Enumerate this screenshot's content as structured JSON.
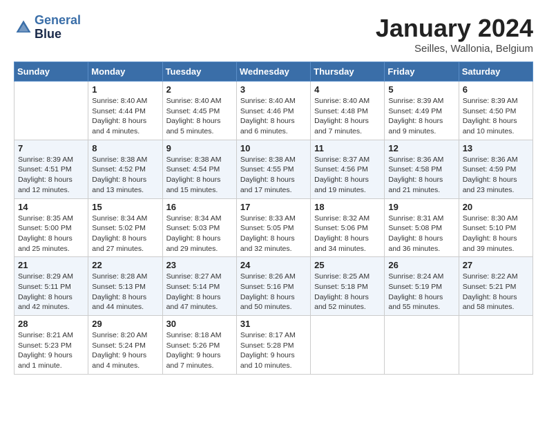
{
  "header": {
    "logo_line1": "General",
    "logo_line2": "Blue",
    "month_title": "January 2024",
    "subtitle": "Seilles, Wallonia, Belgium"
  },
  "days_of_week": [
    "Sunday",
    "Monday",
    "Tuesday",
    "Wednesday",
    "Thursday",
    "Friday",
    "Saturday"
  ],
  "weeks": [
    [
      {
        "day": "",
        "info": ""
      },
      {
        "day": "1",
        "info": "Sunrise: 8:40 AM\nSunset: 4:44 PM\nDaylight: 8 hours\nand 4 minutes."
      },
      {
        "day": "2",
        "info": "Sunrise: 8:40 AM\nSunset: 4:45 PM\nDaylight: 8 hours\nand 5 minutes."
      },
      {
        "day": "3",
        "info": "Sunrise: 8:40 AM\nSunset: 4:46 PM\nDaylight: 8 hours\nand 6 minutes."
      },
      {
        "day": "4",
        "info": "Sunrise: 8:40 AM\nSunset: 4:48 PM\nDaylight: 8 hours\nand 7 minutes."
      },
      {
        "day": "5",
        "info": "Sunrise: 8:39 AM\nSunset: 4:49 PM\nDaylight: 8 hours\nand 9 minutes."
      },
      {
        "day": "6",
        "info": "Sunrise: 8:39 AM\nSunset: 4:50 PM\nDaylight: 8 hours\nand 10 minutes."
      }
    ],
    [
      {
        "day": "7",
        "info": "Sunrise: 8:39 AM\nSunset: 4:51 PM\nDaylight: 8 hours\nand 12 minutes."
      },
      {
        "day": "8",
        "info": "Sunrise: 8:38 AM\nSunset: 4:52 PM\nDaylight: 8 hours\nand 13 minutes."
      },
      {
        "day": "9",
        "info": "Sunrise: 8:38 AM\nSunset: 4:54 PM\nDaylight: 8 hours\nand 15 minutes."
      },
      {
        "day": "10",
        "info": "Sunrise: 8:38 AM\nSunset: 4:55 PM\nDaylight: 8 hours\nand 17 minutes."
      },
      {
        "day": "11",
        "info": "Sunrise: 8:37 AM\nSunset: 4:56 PM\nDaylight: 8 hours\nand 19 minutes."
      },
      {
        "day": "12",
        "info": "Sunrise: 8:36 AM\nSunset: 4:58 PM\nDaylight: 8 hours\nand 21 minutes."
      },
      {
        "day": "13",
        "info": "Sunrise: 8:36 AM\nSunset: 4:59 PM\nDaylight: 8 hours\nand 23 minutes."
      }
    ],
    [
      {
        "day": "14",
        "info": "Sunrise: 8:35 AM\nSunset: 5:00 PM\nDaylight: 8 hours\nand 25 minutes."
      },
      {
        "day": "15",
        "info": "Sunrise: 8:34 AM\nSunset: 5:02 PM\nDaylight: 8 hours\nand 27 minutes."
      },
      {
        "day": "16",
        "info": "Sunrise: 8:34 AM\nSunset: 5:03 PM\nDaylight: 8 hours\nand 29 minutes."
      },
      {
        "day": "17",
        "info": "Sunrise: 8:33 AM\nSunset: 5:05 PM\nDaylight: 8 hours\nand 32 minutes."
      },
      {
        "day": "18",
        "info": "Sunrise: 8:32 AM\nSunset: 5:06 PM\nDaylight: 8 hours\nand 34 minutes."
      },
      {
        "day": "19",
        "info": "Sunrise: 8:31 AM\nSunset: 5:08 PM\nDaylight: 8 hours\nand 36 minutes."
      },
      {
        "day": "20",
        "info": "Sunrise: 8:30 AM\nSunset: 5:10 PM\nDaylight: 8 hours\nand 39 minutes."
      }
    ],
    [
      {
        "day": "21",
        "info": "Sunrise: 8:29 AM\nSunset: 5:11 PM\nDaylight: 8 hours\nand 42 minutes."
      },
      {
        "day": "22",
        "info": "Sunrise: 8:28 AM\nSunset: 5:13 PM\nDaylight: 8 hours\nand 44 minutes."
      },
      {
        "day": "23",
        "info": "Sunrise: 8:27 AM\nSunset: 5:14 PM\nDaylight: 8 hours\nand 47 minutes."
      },
      {
        "day": "24",
        "info": "Sunrise: 8:26 AM\nSunset: 5:16 PM\nDaylight: 8 hours\nand 50 minutes."
      },
      {
        "day": "25",
        "info": "Sunrise: 8:25 AM\nSunset: 5:18 PM\nDaylight: 8 hours\nand 52 minutes."
      },
      {
        "day": "26",
        "info": "Sunrise: 8:24 AM\nSunset: 5:19 PM\nDaylight: 8 hours\nand 55 minutes."
      },
      {
        "day": "27",
        "info": "Sunrise: 8:22 AM\nSunset: 5:21 PM\nDaylight: 8 hours\nand 58 minutes."
      }
    ],
    [
      {
        "day": "28",
        "info": "Sunrise: 8:21 AM\nSunset: 5:23 PM\nDaylight: 9 hours\nand 1 minute."
      },
      {
        "day": "29",
        "info": "Sunrise: 8:20 AM\nSunset: 5:24 PM\nDaylight: 9 hours\nand 4 minutes."
      },
      {
        "day": "30",
        "info": "Sunrise: 8:18 AM\nSunset: 5:26 PM\nDaylight: 9 hours\nand 7 minutes."
      },
      {
        "day": "31",
        "info": "Sunrise: 8:17 AM\nSunset: 5:28 PM\nDaylight: 9 hours\nand 10 minutes."
      },
      {
        "day": "",
        "info": ""
      },
      {
        "day": "",
        "info": ""
      },
      {
        "day": "",
        "info": ""
      }
    ]
  ]
}
